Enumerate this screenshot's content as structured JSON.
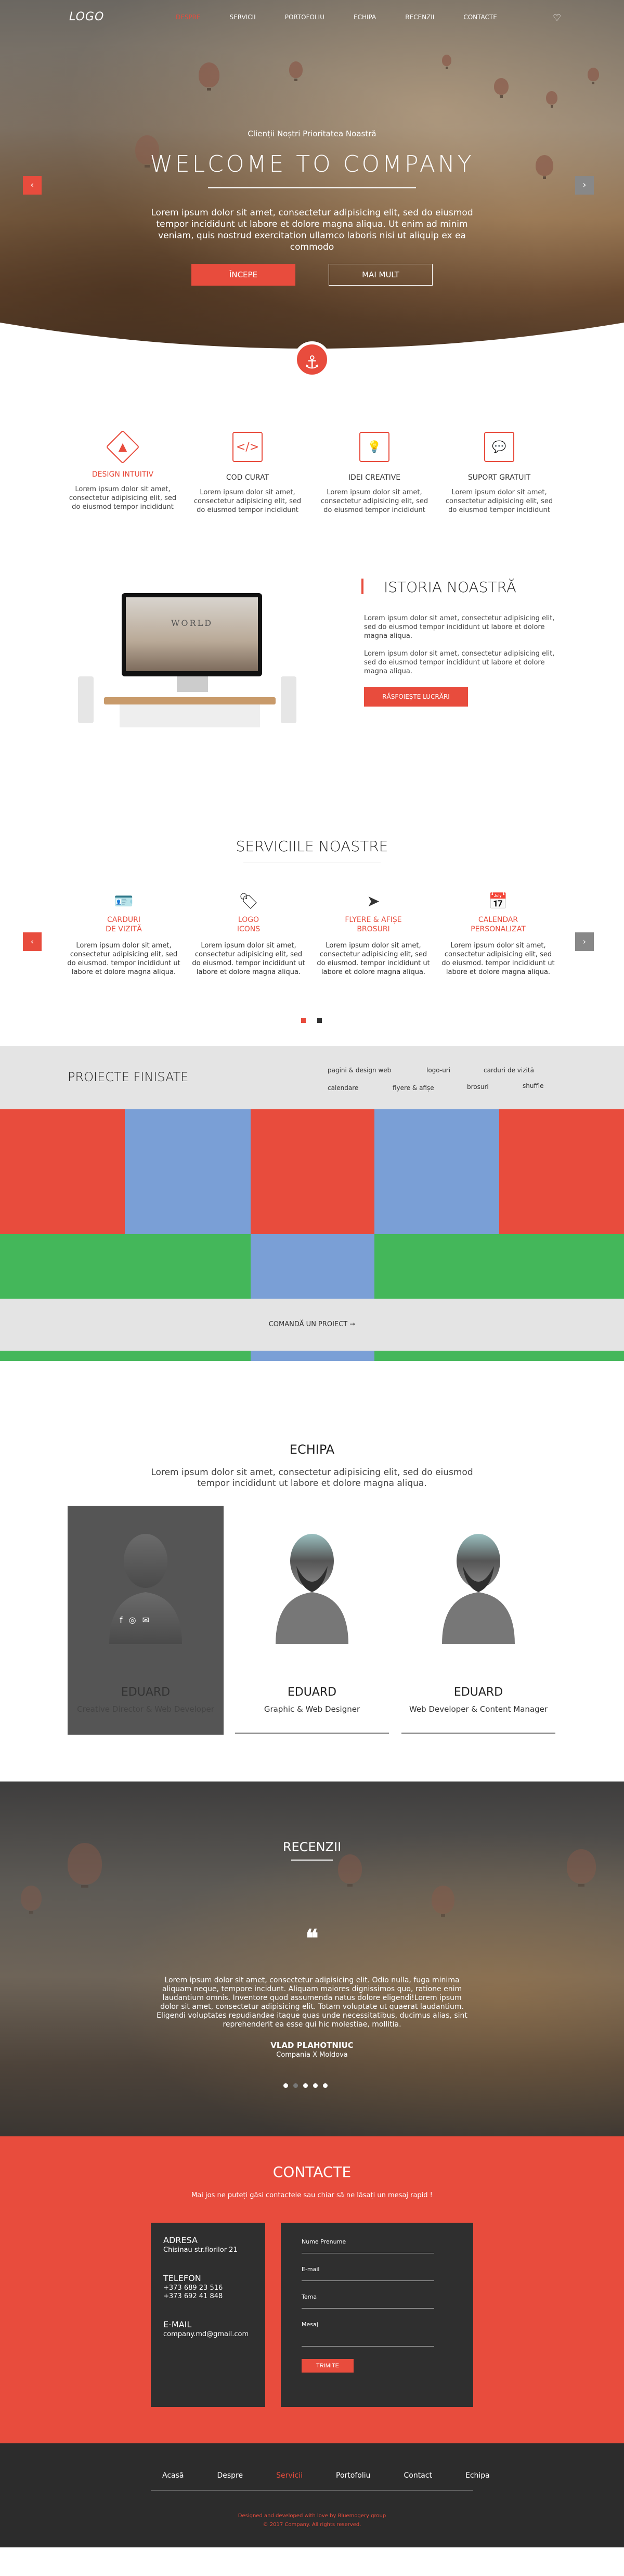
{
  "nav": {
    "logo": "LOGO",
    "items": [
      "DESPRE",
      "SERVICII",
      "PORTOFOLIU",
      "ECHIPA",
      "RECENZII",
      "CONTACTE"
    ],
    "active_index": 0,
    "heart_icon": "heart-icon"
  },
  "hero": {
    "subtitle": "Clienții Noștri Prioritatea Noastră",
    "title": "WELCOME TO COMPANY",
    "text": "Lorem ipsum dolor sit amet, consectetur adipisicing elit, sed do eiusmod tempor incididunt ut labore et dolore magna aliqua. Ut enim ad minim veniam, quis nostrud exercitation ullamco laboris nisi ut aliquip ex ea commodo",
    "primary_button": "ÎNCEPE",
    "secondary_button": "MAI MULT",
    "prev_icon": "chevron-left-icon",
    "next_icon": "chevron-right-icon",
    "anchor_icon": "anchor-icon"
  },
  "features": [
    {
      "icon": "compass-icon",
      "title": "DESIGN INTUITIV",
      "highlight": true,
      "text": "Lorem ipsum dolor sit amet, consectetur adipisicing elit, sed do eiusmod tempor incididunt"
    },
    {
      "icon": "code-icon",
      "title": "COD CURAT",
      "highlight": false,
      "text": "Lorem ipsum dolor sit amet, consectetur adipisicing elit, sed do eiusmod tempor incididunt"
    },
    {
      "icon": "lightbulb-icon",
      "title": "IDEI CREATIVE",
      "highlight": false,
      "text": "Lorem ipsum dolor sit amet, consectetur adipisicing elit, sed do eiusmod tempor incididunt"
    },
    {
      "icon": "chat-icon",
      "title": "SUPORT GRATUIT",
      "highlight": false,
      "text": "Lorem ipsum dolor sit amet, consectetur adipisicing elit, sed do eiusmod tempor incididunt"
    }
  ],
  "history": {
    "screen_text": "WORLD",
    "title": "ISTORIA NOASTRĂ",
    "p1": "Lorem ipsum dolor sit amet, consectetur adipisicing elit, sed do eiusmod tempor incididunt ut labore et dolore magna aliqua.",
    "p2": "Lorem ipsum dolor sit amet, consectetur adipisicing elit, sed do eiusmod tempor incididunt ut labore et dolore magna aliqua.",
    "button": "RĂSFOIEȘTE LUCRĂRI"
  },
  "services": {
    "title": "SERVICIILE NOASTRE",
    "items": [
      {
        "icon": "id-card-icon",
        "title": "CARDURI\nDE VIZITĂ",
        "text": "Lorem ipsum dolor sit amet, consectetur adipisicing elit, sed do eiusmod. tempor incididunt ut labore et dolore magna aliqua."
      },
      {
        "icon": "badge-icon",
        "title": "LOGO\nICONS",
        "text": "Lorem ipsum dolor sit amet, consectetur adipisicing elit, sed do eiusmod. tempor incididunt ut labore et dolore magna aliqua."
      },
      {
        "icon": "paper-plane-icon",
        "title": "FLYERE & AFIȘE\nBROSURI",
        "text": "Lorem ipsum dolor sit amet, consectetur adipisicing elit, sed do eiusmod. tempor incididunt ut labore et dolore magna aliqua."
      },
      {
        "icon": "calendar-icon",
        "title": "CALENDAR\nPERSONALIZAT",
        "text": "Lorem ipsum dolor sit amet, consectetur adipisicing elit, sed do eiusmod. tempor incididunt ut labore et dolore magna aliqua."
      }
    ]
  },
  "projects": {
    "title": "PROIECTE FINISATE",
    "filters": [
      "pagini & design web",
      "logo-uri",
      "carduri de vizită",
      "calendare",
      "flyere & afișe",
      "brosuri",
      "shuffle"
    ],
    "colors": {
      "red": "#e84c3d",
      "blue": "#7a9fd6",
      "green": "#44b75a"
    },
    "footer": "COMANDĂ UN PROIECT ➞"
  },
  "team": {
    "title": "ECHIPA",
    "intro": "Lorem ipsum dolor sit amet, consectetur adipisicing elit, sed do eiusmod tempor incididunt ut labore et dolore magna aliqua.",
    "members": [
      {
        "name": "EDUARD",
        "role": "Creative Director & Web Developer"
      },
      {
        "name": "EDUARD",
        "role": "Graphic & Web Designer"
      },
      {
        "name": "EDUARD",
        "role": "Web Developer & Content Manager"
      }
    ],
    "socials": [
      "facebook-icon",
      "instagram-icon",
      "mail-icon"
    ]
  },
  "reviews": {
    "title": "RECENZII",
    "quote_mark": "❝",
    "text": "Lorem ipsum dolor sit amet, consectetur adipisicing elit. Odio nulla, fuga minima aliquam neque, tempore incidunt. Aliquam maiores dignissimos quo, ratione enim laudantium omnis. Inventore quod assumenda natus dolore eligendi!Lorem ipsum dolor sit amet, consectetur adipisicing elit. Totam voluptate ut quaerat laudantium. Eligendi voluptates repudiandae itaque quas unde necessitatibus, ducimus alias, sint reprehenderit ea esse qui hic molestiae, mollitia.",
    "name": "VLAD PLAHOTNIUC",
    "company": "Compania X Moldova"
  },
  "contact": {
    "title": "CONTACTE",
    "subtitle": "Mai jos ne puteți găsi contactele sau chiar să ne lăsați un mesaj rapid !",
    "address_label": "ADRESA",
    "address": "Chisinau str.florilor 21",
    "phone_label": "TELEFON",
    "phones": [
      "+373 689 23 516",
      "+373 692 41 848"
    ],
    "email_label": "E-MAIL",
    "email": "company.md@gmail.com",
    "fields": [
      "Nume Prenume",
      "E-mail",
      "Tema",
      "Mesaj"
    ],
    "send": "TRIMITE"
  },
  "footer": {
    "links": [
      "Acasă",
      "Despre",
      "Servicii",
      "Portofoliu",
      "Contact",
      "Echipa"
    ],
    "active_index": 2,
    "credit": "Designed and developed with love by Bluemogery group",
    "copyright": "© 2017 Company. All rights reserved."
  }
}
